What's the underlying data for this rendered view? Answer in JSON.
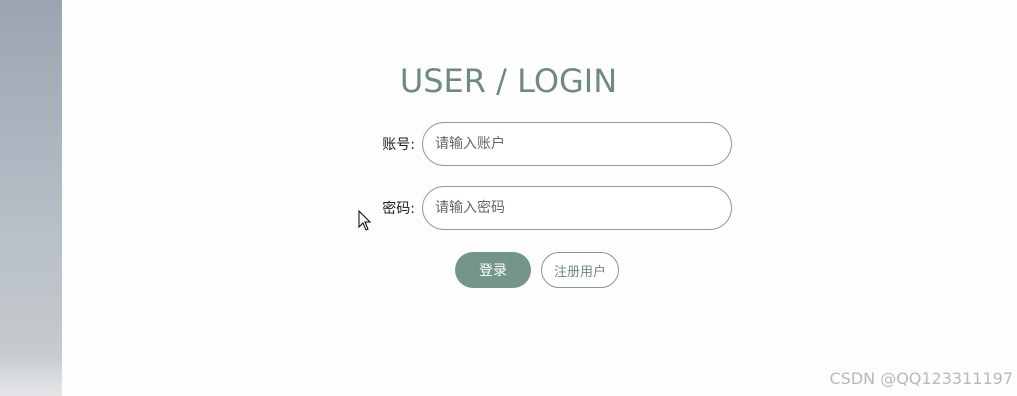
{
  "login": {
    "title": "USER / LOGIN",
    "account_label": "账号:",
    "account_placeholder": "请输入账户",
    "password_label": "密码:",
    "password_placeholder": "请输入密码",
    "login_button": "登录",
    "register_button": "注册用户"
  },
  "watermark": "CSDN @QQ123311197",
  "colors": {
    "accent": "#74968a",
    "title": "#6f8a80",
    "border": "#8a9790"
  }
}
